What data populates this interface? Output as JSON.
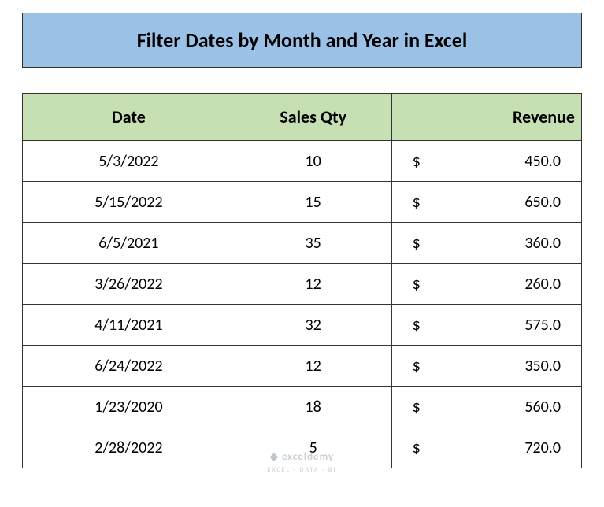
{
  "title": "Filter Dates by Month and Year in Excel",
  "headers": {
    "date": "Date",
    "qty": "Sales Qty",
    "revenue": "Revenue"
  },
  "currency_symbol": "$",
  "rows": [
    {
      "date": "5/3/2022",
      "qty": "10",
      "revenue": "450.0"
    },
    {
      "date": "5/15/2022",
      "qty": "15",
      "revenue": "650.0"
    },
    {
      "date": "6/5/2021",
      "qty": "35",
      "revenue": "360.0"
    },
    {
      "date": "3/26/2022",
      "qty": "12",
      "revenue": "260.0"
    },
    {
      "date": "4/11/2021",
      "qty": "32",
      "revenue": "575.0"
    },
    {
      "date": "6/24/2022",
      "qty": "12",
      "revenue": "350.0"
    },
    {
      "date": "1/23/2020",
      "qty": "18",
      "revenue": "560.0"
    },
    {
      "date": "2/28/2022",
      "qty": "5",
      "revenue": "720.0"
    }
  ],
  "watermark": {
    "brand": "exceldemy",
    "tagline": "EXCEL · DATA · BI"
  }
}
